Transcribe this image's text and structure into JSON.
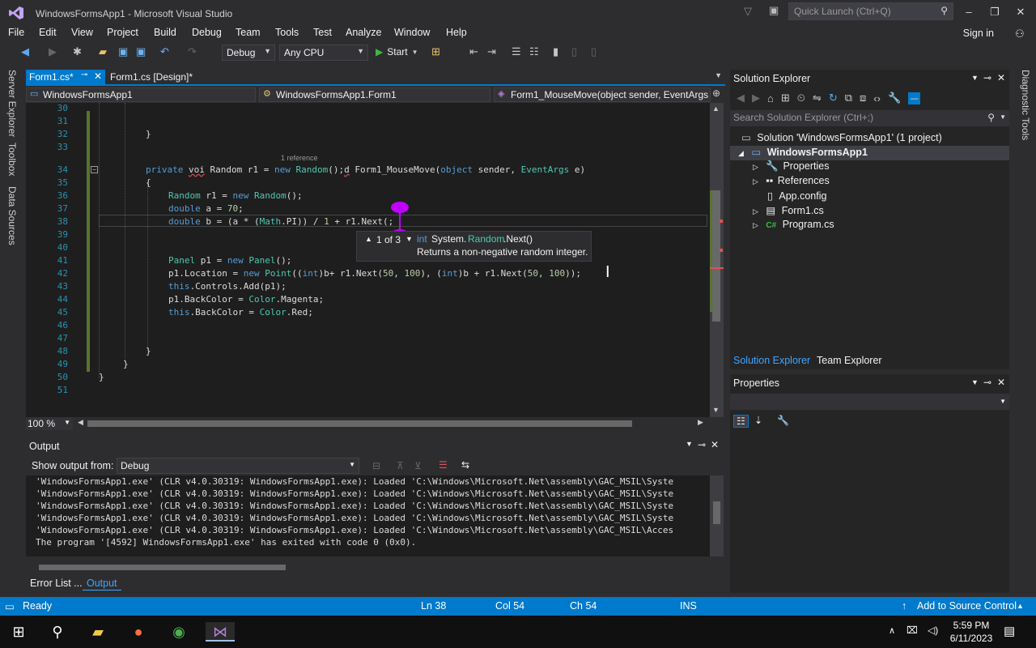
{
  "window": {
    "title": "WindowsFormsApp1 - Microsoft Visual Studio",
    "quick_launch": "Quick Launch (Ctrl+Q)",
    "sign_in": "Sign in"
  },
  "menu": [
    "File",
    "Edit",
    "View",
    "Project",
    "Build",
    "Debug",
    "Team",
    "Tools",
    "Test",
    "Analyze",
    "Window",
    "Help"
  ],
  "toolbar": {
    "config": "Debug",
    "platform": "Any CPU",
    "start": "Start"
  },
  "left_tabs": [
    "Server Explorer",
    "Toolbox",
    "Data Sources"
  ],
  "right_tabs": [
    "Diagnostic Tools"
  ],
  "doc_tabs": [
    {
      "label": "Form1.cs*",
      "active": true
    },
    {
      "label": "Form1.cs [Design]*",
      "active": false
    }
  ],
  "nav": {
    "project": "WindowsFormsApp1",
    "class": "WindowsFormsApp1.Form1",
    "member": "Form1_MouseMove(object sender, EventArgs e)"
  },
  "editor": {
    "line_numbers": [
      "30",
      "31",
      "32",
      "33",
      "34",
      "35",
      "36",
      "37",
      "38",
      "39",
      "40",
      "41",
      "42",
      "43",
      "44",
      "45",
      "46",
      "47",
      "48",
      "49",
      "50",
      "51"
    ],
    "reference_hint": "1 reference",
    "zoom": "100 %"
  },
  "tooltip": {
    "counter": "1 of 3",
    "sig_type": "int",
    "sig_ns": "System.",
    "sig_class": "Random",
    "sig_method": ".Next()",
    "description": "Returns a non-negative random integer."
  },
  "output": {
    "title": "Output",
    "show_from_label": "Show output from:",
    "source": "Debug",
    "lines": [
      "'WindowsFormsApp1.exe' (CLR v4.0.30319: WindowsFormsApp1.exe): Loaded 'C:\\Windows\\Microsoft.Net\\assembly\\GAC_MSIL\\Syste",
      "'WindowsFormsApp1.exe' (CLR v4.0.30319: WindowsFormsApp1.exe): Loaded 'C:\\Windows\\Microsoft.Net\\assembly\\GAC_MSIL\\Syste",
      "'WindowsFormsApp1.exe' (CLR v4.0.30319: WindowsFormsApp1.exe): Loaded 'C:\\Windows\\Microsoft.Net\\assembly\\GAC_MSIL\\Syste",
      "'WindowsFormsApp1.exe' (CLR v4.0.30319: WindowsFormsApp1.exe): Loaded 'C:\\Windows\\Microsoft.Net\\assembly\\GAC_MSIL\\Syste",
      "'WindowsFormsApp1.exe' (CLR v4.0.30319: WindowsFormsApp1.exe): Loaded 'C:\\Windows\\Microsoft.Net\\assembly\\GAC_MSIL\\Acces",
      "The program '[4592] WindowsFormsApp1.exe' has exited with code 0 (0x0)."
    ]
  },
  "bottom_tabs": [
    "Error List ...",
    "Output"
  ],
  "solution_explorer": {
    "title": "Solution Explorer",
    "search": "Search Solution Explorer (Ctrl+;)",
    "solution": "Solution 'WindowsFormsApp1' (1 project)",
    "project": "WindowsFormsApp1",
    "items": [
      "Properties",
      "References",
      "App.config",
      "Form1.cs",
      "Program.cs"
    ],
    "tabs": [
      "Solution Explorer",
      "Team Explorer"
    ]
  },
  "properties": {
    "title": "Properties"
  },
  "status": {
    "ready": "Ready",
    "ln": "Ln 38",
    "col": "Col 54",
    "ch": "Ch 54",
    "ins": "INS",
    "source_control": "Add to Source Control"
  },
  "taskbar": {
    "time": "5:59 PM",
    "date": "6/11/2023"
  },
  "colors": {
    "accent": "#007acc",
    "editor_bg": "#1e1e1e",
    "keyword": "#569cd6",
    "type": "#4ec9b0",
    "line_number": "#2b91af"
  }
}
